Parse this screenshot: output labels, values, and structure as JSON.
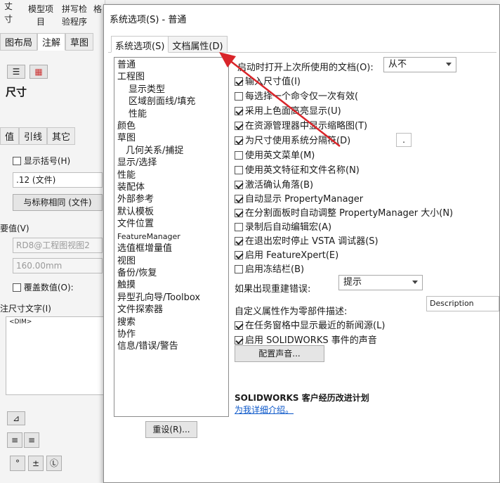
{
  "background": {
    "toolbar_items": [
      "模型项",
      "目",
      "拼写检",
      "验程序",
      "格"
    ],
    "tabs": [
      "图布局",
      "注解",
      "草图"
    ],
    "heading": "尺寸",
    "subtabs": [
      "值",
      "引线",
      "其它"
    ],
    "show_parentheses": "显示括号(H)",
    "precision_value": ".12 (文件)",
    "tolerance_value": "与标称相同 (文件)",
    "primary_value_label": "要值(V)",
    "primary_value_field": "RD8@工程图视图2",
    "dimension_value_field": "160.00mm",
    "override_value": "覆盖数值(O):",
    "dim_text_label": "注尺寸文字(I)",
    "dim_text_value": "<DIM>",
    "symbols": [
      "°",
      "±",
      "Ⓛ"
    ]
  },
  "dialog": {
    "title": "系统选项(S) - 普通",
    "tabs": [
      "系统选项(S)",
      "文档属性(D)"
    ],
    "tree": [
      {
        "label": "普通",
        "level": 0
      },
      {
        "label": "工程图",
        "level": 0
      },
      {
        "label": "显示类型",
        "level": 1
      },
      {
        "label": "区域剖面线/填充",
        "level": 1
      },
      {
        "label": "性能",
        "level": 1
      },
      {
        "label": "颜色",
        "level": 0
      },
      {
        "label": "草图",
        "level": 0
      },
      {
        "label": "几何关系/捕捉",
        "level": 1
      },
      {
        "label": "显示/选择",
        "level": 0
      },
      {
        "label": "性能",
        "level": 0
      },
      {
        "label": "装配体",
        "level": 0
      },
      {
        "label": "外部参考",
        "level": 0
      },
      {
        "label": "默认模板",
        "level": 0
      },
      {
        "label": "文件位置",
        "level": 0
      },
      {
        "label": "FeatureManager",
        "level": 0
      },
      {
        "label": "选值框增量值",
        "level": 0
      },
      {
        "label": "视图",
        "level": 0
      },
      {
        "label": "备份/恢复",
        "level": 0
      },
      {
        "label": "触摸",
        "level": 0
      },
      {
        "label": "异型孔向导/Toolbox",
        "level": 0
      },
      {
        "label": "文件探索器",
        "level": 0
      },
      {
        "label": "搜索",
        "level": 0
      },
      {
        "label": "协作",
        "level": 0
      },
      {
        "label": "信息/错误/警告",
        "level": 0
      }
    ],
    "reset_button": "重设(R)...",
    "open_last_doc_label": "启动时打开上次所使用的文档(O):",
    "open_last_doc_value": "从不",
    "options": [
      {
        "label": "输入尺寸值(I)",
        "checked": true
      },
      {
        "label": "每选择一个命令仅一次有效(",
        "checked": false
      },
      {
        "label": "采用上色面高亮显示(U)",
        "checked": true
      },
      {
        "label": "在资源管理器中显示缩略图(T)",
        "checked": true
      },
      {
        "label": "为尺寸使用系统分隔符(D)",
        "checked": true
      },
      {
        "label": "使用英文菜单(M)",
        "checked": false
      },
      {
        "label": "使用英文特征和文件名称(N)",
        "checked": false
      },
      {
        "label": "激活确认角落(B)",
        "checked": true
      },
      {
        "label": "自动显示 PropertyManager",
        "checked": true
      },
      {
        "label": "在分割面板时自动调整 PropertyManager 大小(N)",
        "checked": true
      },
      {
        "label": "录制后自动编辑宏(A)",
        "checked": false
      },
      {
        "label": "在退出宏时停止 VSTA 调试器(S)",
        "checked": true
      },
      {
        "label": "启用 FeatureXpert(E)",
        "checked": true
      },
      {
        "label": "启用冻结栏(B)",
        "checked": false
      }
    ],
    "separator_value": ".",
    "rebuild_error_label": "如果出现重建错误:",
    "rebuild_error_value": "提示",
    "custom_prop_label": "自定义属性作为零部件描述:",
    "custom_prop_value": "Description",
    "news_option": {
      "label": "在任务窗格中显示最近的新闻源(L)",
      "checked": true
    },
    "sound_option": {
      "label": "启用 SOLIDWORKS 事件的声音",
      "checked": true
    },
    "config_sound_button": "配置声音...",
    "ceip_title": "SOLIDWORKS 客户经历改进计划",
    "ceip_link": "为我详细介绍。"
  },
  "colors": {
    "arrow": "#d9252a",
    "link": "#0b57c9"
  }
}
